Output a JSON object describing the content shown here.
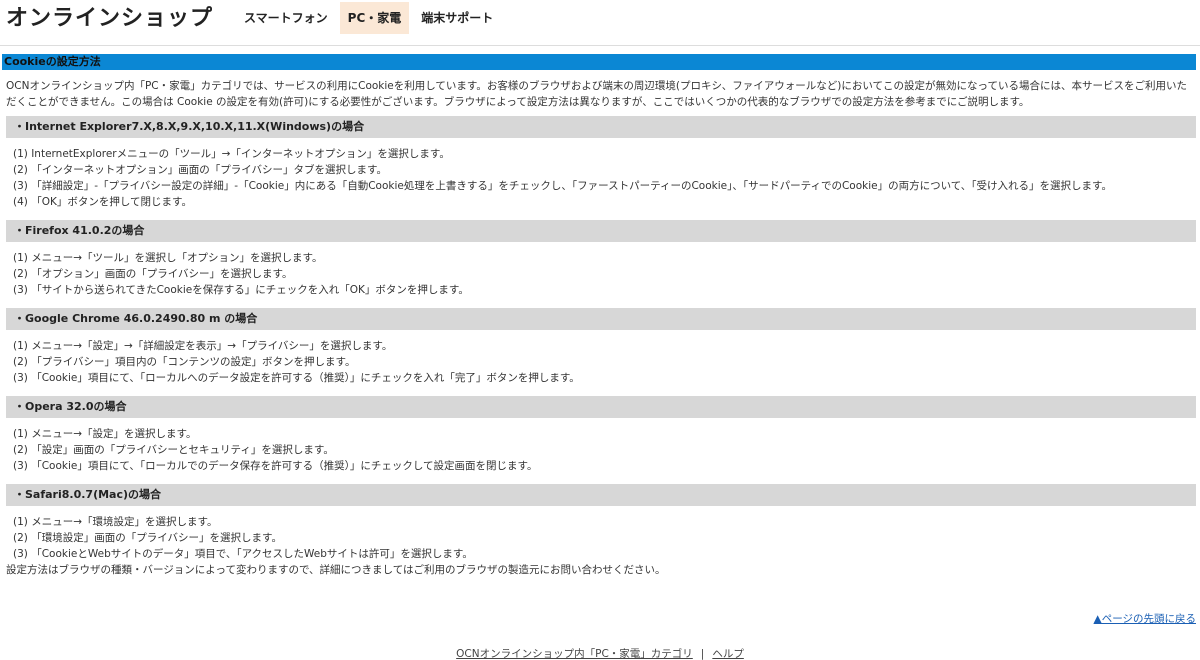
{
  "header": {
    "logo": "オンラインショップ",
    "nav": [
      {
        "label": "スマートフォン",
        "active": false
      },
      {
        "label": "PC・家電",
        "active": true
      },
      {
        "label": "端末サポート",
        "active": false
      }
    ]
  },
  "content": {
    "title": "Cookieの設定方法",
    "intro": "OCNオンラインショップ内「PC・家電」カテゴリでは、サービスの利用にCookieを利用しています。お客様のブラウザおよび端末の周辺環境(プロキシ、ファイアウォールなど)においてこの設定が無効になっている場合には、本サービスをご利用いただくことができません。この場合は Cookie の設定を有効(許可)にする必要性がございます。ブラウザによって設定方法は異なりますが、ここではいくつかの代表的なブラウザでの設定方法を参考までにご説明します。",
    "browsers": [
      {
        "name": "・Internet Explorer7.X,8.X,9.X,10.X,11.X(Windows)の場合",
        "steps": [
          "(1) InternetExplorerメニューの「ツール」→「インターネットオプション」を選択します。",
          "(2) 「インターネットオプション」画面の「プライバシー」タブを選択します。",
          "(3) 「詳細設定」-「プライバシー設定の詳細」-「Cookie」内にある「自動Cookie処理を上書きする」をチェックし、「ファーストパーティーのCookie」、「サードパーティでのCookie」の両方について、「受け入れる」を選択します。",
          "(4) 「OK」ボタンを押して閉じます。"
        ]
      },
      {
        "name": "・Firefox 41.0.2の場合",
        "steps": [
          "(1) メニュー→「ツール」を選択し「オプション」を選択します。",
          "(2) 「オプション」画面の「プライバシー」を選択します。",
          "(3) 「サイトから送られてきたCookieを保存する」にチェックを入れ「OK」ボタンを押します。"
        ]
      },
      {
        "name": "・Google Chrome 46.0.2490.80 m の場合",
        "steps": [
          "(1) メニュー→「設定」→「詳細設定を表示」→「プライバシー」を選択します。",
          "(2) 「プライバシー」項目内の「コンテンツの設定」ボタンを押します。",
          "(3) 「Cookie」項目にて、「ローカルへのデータ設定を許可する（推奨）」にチェックを入れ「完了」ボタンを押します。"
        ]
      },
      {
        "name": "・Opera 32.0の場合",
        "steps": [
          "(1) メニュー→「設定」を選択します。",
          "(2) 「設定」画面の「プライバシーとセキュリティ」を選択します。",
          "(3) 「Cookie」項目にて、「ローカルでのデータ保存を許可する（推奨）」にチェックして設定画面を閉じます。"
        ]
      },
      {
        "name": "・Safari8.0.7(Mac)の場合",
        "steps": [
          "(1) メニュー→「環境設定」を選択します。",
          "(2) 「環境設定」画面の「プライバシー」を選択します。",
          "(3) 「CookieとWebサイトのデータ」項目で、「アクセスしたWebサイトは許可」を選択します。"
        ]
      }
    ],
    "note": "設定方法はブラウザの種類・バージョンによって変わりますので、詳細につきましてはご利用のブラウザの製造元にお問い合わせください。"
  },
  "back_to_top": "▲ページの先頭に戻る",
  "footer": {
    "link1": "OCNオンラインショップ内「PC・家電」カテゴリ",
    "separator": "|",
    "link2": "ヘルプ"
  },
  "colors": {
    "title_bar": "#0b87d4",
    "section_header": "#d7d7d7",
    "active_nav": "#fbe8d6",
    "link": "#1a5fb4"
  }
}
